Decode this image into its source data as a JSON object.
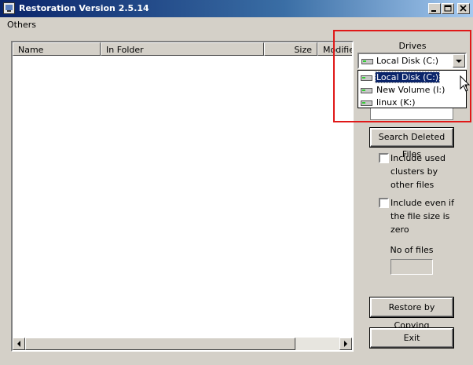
{
  "window": {
    "title": "Restoration Version 2.5.14",
    "icon": "app-icon",
    "controls": [
      "minimize-icon",
      "maximize-icon",
      "close-icon"
    ]
  },
  "menu": {
    "items": [
      "Others"
    ]
  },
  "list": {
    "columns": [
      "Name",
      "In Folder",
      "Size",
      "Modified"
    ],
    "rows": []
  },
  "drives": {
    "label": "Drives",
    "selected": "Local Disk (C:)",
    "options": [
      {
        "label": "Local Disk (C:)",
        "icon": "drive-icon",
        "selected": true
      },
      {
        "label": "New Volume (I:)",
        "icon": "drive-icon",
        "selected": false
      },
      {
        "label": "linux (K:)",
        "icon": "drive-icon",
        "selected": false
      }
    ]
  },
  "buttons": {
    "search": "Search Deleted Files",
    "restore": "Restore by Copying",
    "exit": "Exit"
  },
  "options": {
    "include_used": {
      "lines": [
        "Include used",
        "clusters by",
        "other files"
      ],
      "checked": false
    },
    "include_zero": {
      "lines": [
        "Include even if",
        "the file size is",
        "zero"
      ],
      "checked": false
    }
  },
  "no_of_files": {
    "label": "No of files",
    "value": ""
  },
  "colors": {
    "highlight": "#e01818",
    "selection": "#0a246a",
    "face": "#d4d0c8"
  }
}
